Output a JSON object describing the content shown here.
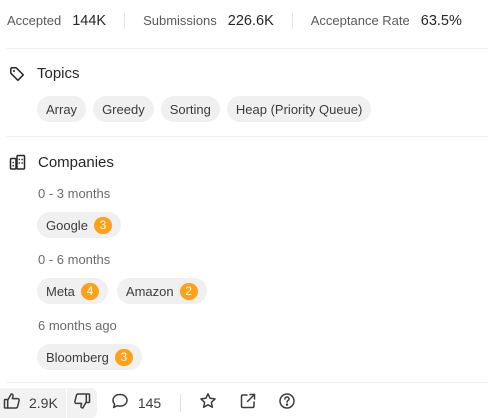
{
  "stats": {
    "accepted_label": "Accepted",
    "accepted_value": "144K",
    "submissions_label": "Submissions",
    "submissions_value": "226.6K",
    "rate_label": "Acceptance Rate",
    "rate_value": "63.5%"
  },
  "topics": {
    "title": "Topics",
    "icon": "tag-icon",
    "tags": [
      "Array",
      "Greedy",
      "Sorting",
      "Heap (Priority Queue)"
    ]
  },
  "companies": {
    "title": "Companies",
    "icon": "building-icon",
    "groups": [
      {
        "period": "0 - 3 months",
        "items": [
          {
            "name": "Google",
            "count": "3"
          }
        ]
      },
      {
        "period": "0 - 6 months",
        "items": [
          {
            "name": "Meta",
            "count": "4"
          },
          {
            "name": "Amazon",
            "count": "2"
          }
        ]
      },
      {
        "period": "6 months ago",
        "items": [
          {
            "name": "Bloomberg",
            "count": "3"
          }
        ]
      }
    ]
  },
  "bottom_bar": {
    "likes": "2.9K",
    "comments": "145",
    "icons": [
      "thumbs-up-icon",
      "thumbs-down-icon",
      "comment-icon",
      "star-icon",
      "share-icon",
      "help-icon"
    ]
  },
  "colors": {
    "badge": "#ffa116",
    "chip_bg": "#f0f0f0",
    "text_primary": "#262626",
    "text_secondary": "#5a5a5a"
  }
}
